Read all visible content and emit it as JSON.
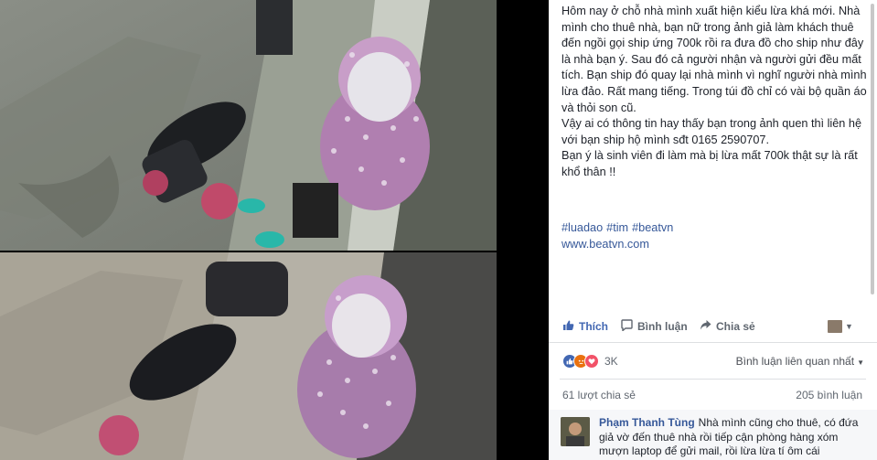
{
  "post": {
    "caption": "Hôm nay ở chỗ nhà mình xuất hiện kiểu lừa khá mới. Nhà mình cho thuê nhà, bạn nữ trong ảnh giả làm khách thuê đến ngồi gọi ship ứng 700k rồi ra đưa đồ cho ship như đây là nhà bạn ý. Sau đó cả người nhận và người gửi đều mất tích. Bạn ship đó quay lại nhà mình vì nghĩ người nhà mình lừa đảo. Rất mang tiếng. Trong túi đồ chỉ có vài bộ quần áo và thỏi son cũ.\nVậy ai có thông tin hay thấy bạn trong ảnh quen thì liên hệ với bạn ship hộ mình sđt 0165 2590707.\nBạn ý là sinh viên đi làm mà bị lừa mất 700k thật sự là rất khổ thân !!",
    "hashtags": [
      "#luadao",
      "#tim",
      "#beatvn"
    ],
    "website": "www.beatvn.com"
  },
  "actions": {
    "like": "Thích",
    "comment": "Bình luận",
    "share": "Chia sẻ"
  },
  "reactions": {
    "count": "3K",
    "sort_label": "Bình luận liên quan nhất"
  },
  "stats": {
    "shares": "61 lượt chia sẻ",
    "comments": "205 bình luận"
  },
  "first_comment": {
    "author": "Phạm Thanh Tùng",
    "text": "Nhà mình cũng cho thuê, có đứa giả vờ đến thuê nhà rồi tiếp cận phòng hàng xóm mượn laptop để gửi mail, rồi lừa lừa tí ôm cái"
  },
  "colors": {
    "link": "#365899",
    "like_blue": "#4267b2",
    "text": "#1d2129",
    "muted": "#606770"
  }
}
